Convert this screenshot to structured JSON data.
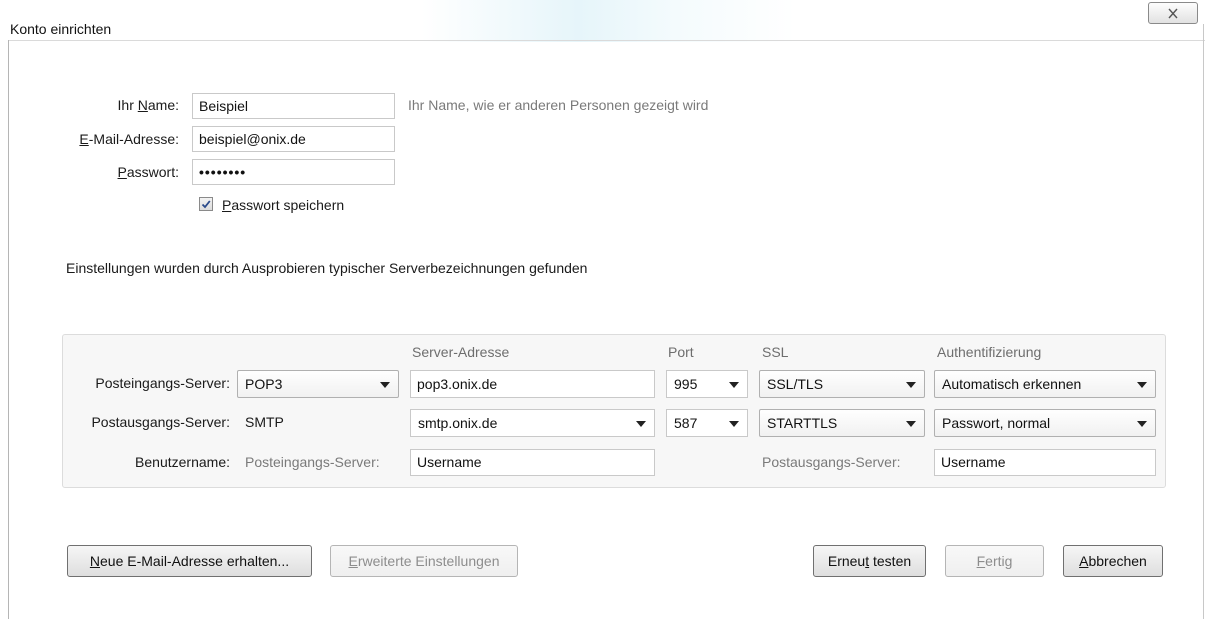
{
  "window": {
    "title": "Konto einrichten",
    "close_icon": "close-icon"
  },
  "account": {
    "name_label_pre": "Ihr ",
    "name_label_key": "N",
    "name_label_post": "ame:",
    "name_value": "Beispiel",
    "name_hint": "Ihr Name, wie er anderen Personen gezeigt wird",
    "email_label_key": "E",
    "email_label_post": "-Mail-Adresse:",
    "email_value": "beispiel@onix.de",
    "password_label_key": "P",
    "password_label_post": "asswort:",
    "password_value": "••••••••",
    "remember_checked": true,
    "remember_label_key": "P",
    "remember_label_post": "asswort speichern"
  },
  "status_message": "Einstellungen wurden durch Ausprobieren typischer Serverbezeichnungen gefunden",
  "server_table": {
    "headers": {
      "server_address": "Server-Adresse",
      "port": "Port",
      "ssl": "SSL",
      "auth": "Authentifizierung"
    },
    "incoming": {
      "label": "Posteingangs-Server:",
      "protocol": "POP3",
      "server": "pop3.onix.de",
      "port": "995",
      "ssl": "SSL/TLS",
      "auth": "Automatisch erkennen"
    },
    "outgoing": {
      "label": "Postausgangs-Server:",
      "protocol": "SMTP",
      "server": "smtp.onix.de",
      "port": "587",
      "ssl": "STARTTLS",
      "auth": "Passwort, normal"
    },
    "username": {
      "label": "Benutzername:",
      "incoming_label": "Posteingangs-Server:",
      "incoming_value": "Username",
      "outgoing_label": "Postausgangs-Server:",
      "outgoing_value": "Username"
    }
  },
  "buttons": {
    "new_email": {
      "key": "N",
      "rest": "eue E-Mail-Adresse erhalten..."
    },
    "advanced": {
      "key": "E",
      "rest": "rweiterte Einstellungen"
    },
    "retest": {
      "pre": "Erneu",
      "key": "t",
      "post": " testen"
    },
    "done": {
      "key": "F",
      "rest": "ertig"
    },
    "cancel": {
      "key": "A",
      "rest": "bbrechen"
    }
  }
}
